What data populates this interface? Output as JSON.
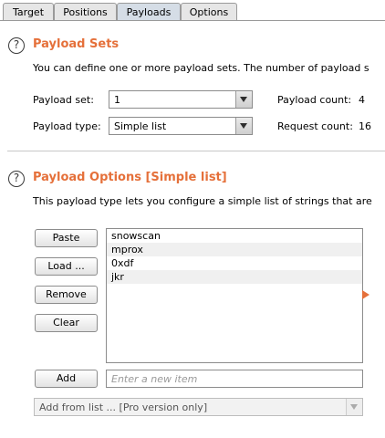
{
  "tabs": [
    {
      "label": "Target"
    },
    {
      "label": "Positions"
    },
    {
      "label": "Payloads"
    },
    {
      "label": "Options"
    }
  ],
  "active_tab": "Payloads",
  "payload_sets": {
    "title": "Payload Sets",
    "description": "You can define one or more payload sets. The number of payload s",
    "set_label": "Payload set:",
    "set_value": "1",
    "type_label": "Payload type:",
    "type_value": "Simple list",
    "payload_count_label": "Payload count:",
    "payload_count": "4",
    "request_count_label": "Request count:",
    "request_count": "16"
  },
  "payload_options": {
    "title": "Payload Options [Simple list]",
    "description": "This payload type lets you configure a simple list of strings that are",
    "buttons": {
      "paste": "Paste",
      "load": "Load ...",
      "remove": "Remove",
      "clear": "Clear",
      "add": "Add"
    },
    "items": [
      "snowscan",
      "mprox",
      "0xdf",
      "jkr"
    ],
    "new_item_placeholder": "Enter a new item",
    "add_from_list": "Add from list ... [Pro version only]"
  },
  "colors": {
    "accent": "#e5703a",
    "active_tab": "#d5dde6"
  }
}
